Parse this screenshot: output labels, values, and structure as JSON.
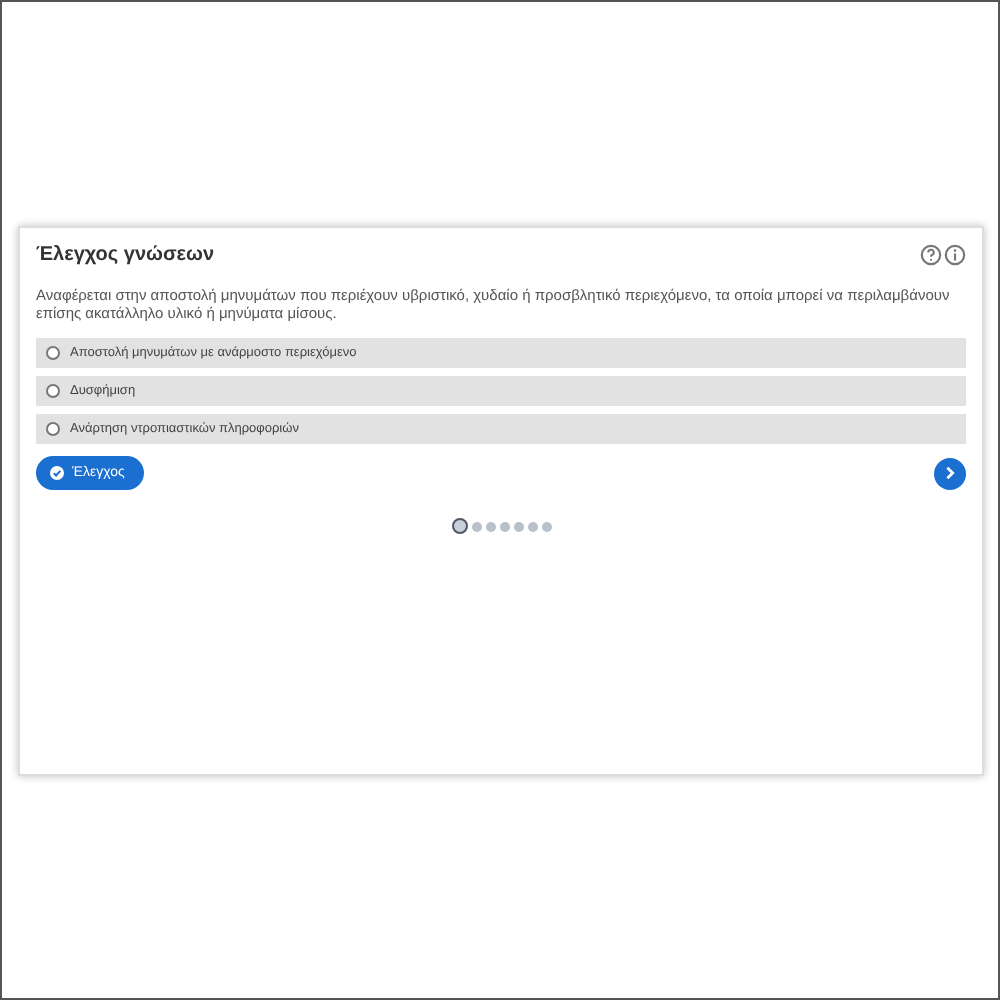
{
  "card": {
    "title": "Έλεγχος γνώσεων",
    "question": "Αναφέρεται στην αποστολή μηνυμάτων που περιέχουν υβριστικό, χυδαίο ή προσβλητικό περιεχόμενο, τα οποία μπορεί να περιλαμβάνουν επίσης ακατάλληλο υλικό ή μηνύματα μίσους.",
    "options": [
      {
        "label": "Αποστολή μηνυμάτων με ανάρμοστο περιεχόμενο",
        "selected": false
      },
      {
        "label": "Δυσφήμιση",
        "selected": false
      },
      {
        "label": "Ανάρτηση ντροπιαστικών πληροφοριών",
        "selected": false
      }
    ],
    "check_button": "Έλεγχος",
    "pager": [
      {
        "selected": true
      },
      {
        "selected": false
      },
      {
        "selected": false
      },
      {
        "selected": false
      },
      {
        "selected": false
      },
      {
        "selected": false
      },
      {
        "selected": false
      }
    ]
  }
}
